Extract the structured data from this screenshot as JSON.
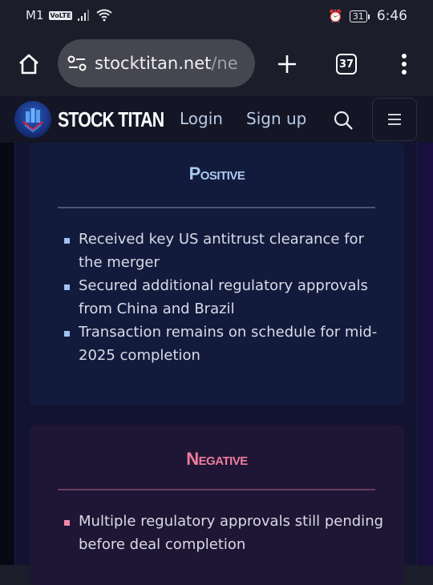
{
  "status_bar": {
    "carrier": "M1",
    "volte": "VoLTE",
    "battery": "31",
    "time": "6:46"
  },
  "browser": {
    "url_main": "stocktitan.net",
    "url_rest": "/ne",
    "tab_count": "37"
  },
  "header": {
    "brand": "STOCK TITAN",
    "login": "Login",
    "signup": "Sign up"
  },
  "positive": {
    "title": "Positive",
    "accent": "#a9caf0",
    "items": [
      "Received key US antitrust clearance for the merger",
      "Secured additional regulatory approvals from China and Brazil",
      "Transaction remains on schedule for mid-2025 completion"
    ]
  },
  "negative": {
    "title": "Negative",
    "accent": "#ef7c9f",
    "items": [
      "Multiple regulatory approvals still pending before deal completion"
    ]
  }
}
